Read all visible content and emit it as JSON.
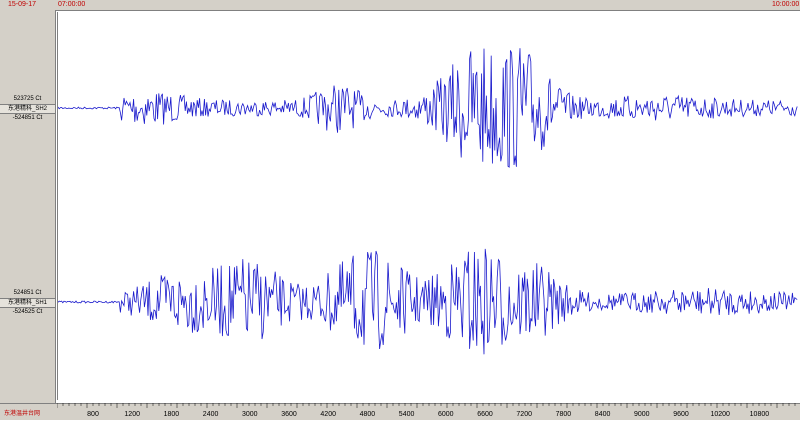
{
  "header": {
    "date": "15-09-17",
    "time_start": "07:00:00",
    "time_end": "10:00:00"
  },
  "channels": [
    {
      "max": "523725 Ct",
      "name": "东港精科_SH2",
      "min": "-524851 Ct"
    },
    {
      "max": "524851 Ct",
      "name": "东港精科_SH1",
      "min": "-524525 Ct"
    }
  ],
  "footer": {
    "station": "东港温井台网"
  },
  "ruler": {
    "ticks": [
      "800",
      "1200",
      "1800",
      "2400",
      "3000",
      "3600",
      "4200",
      "4800",
      "5400",
      "6000",
      "6600",
      "7200",
      "7800",
      "8400",
      "9000",
      "9600",
      "10200",
      "10800"
    ]
  },
  "colors": {
    "trace": "#1a1acc",
    "panel": "#d4d0c8",
    "accent": "#c00000"
  }
}
